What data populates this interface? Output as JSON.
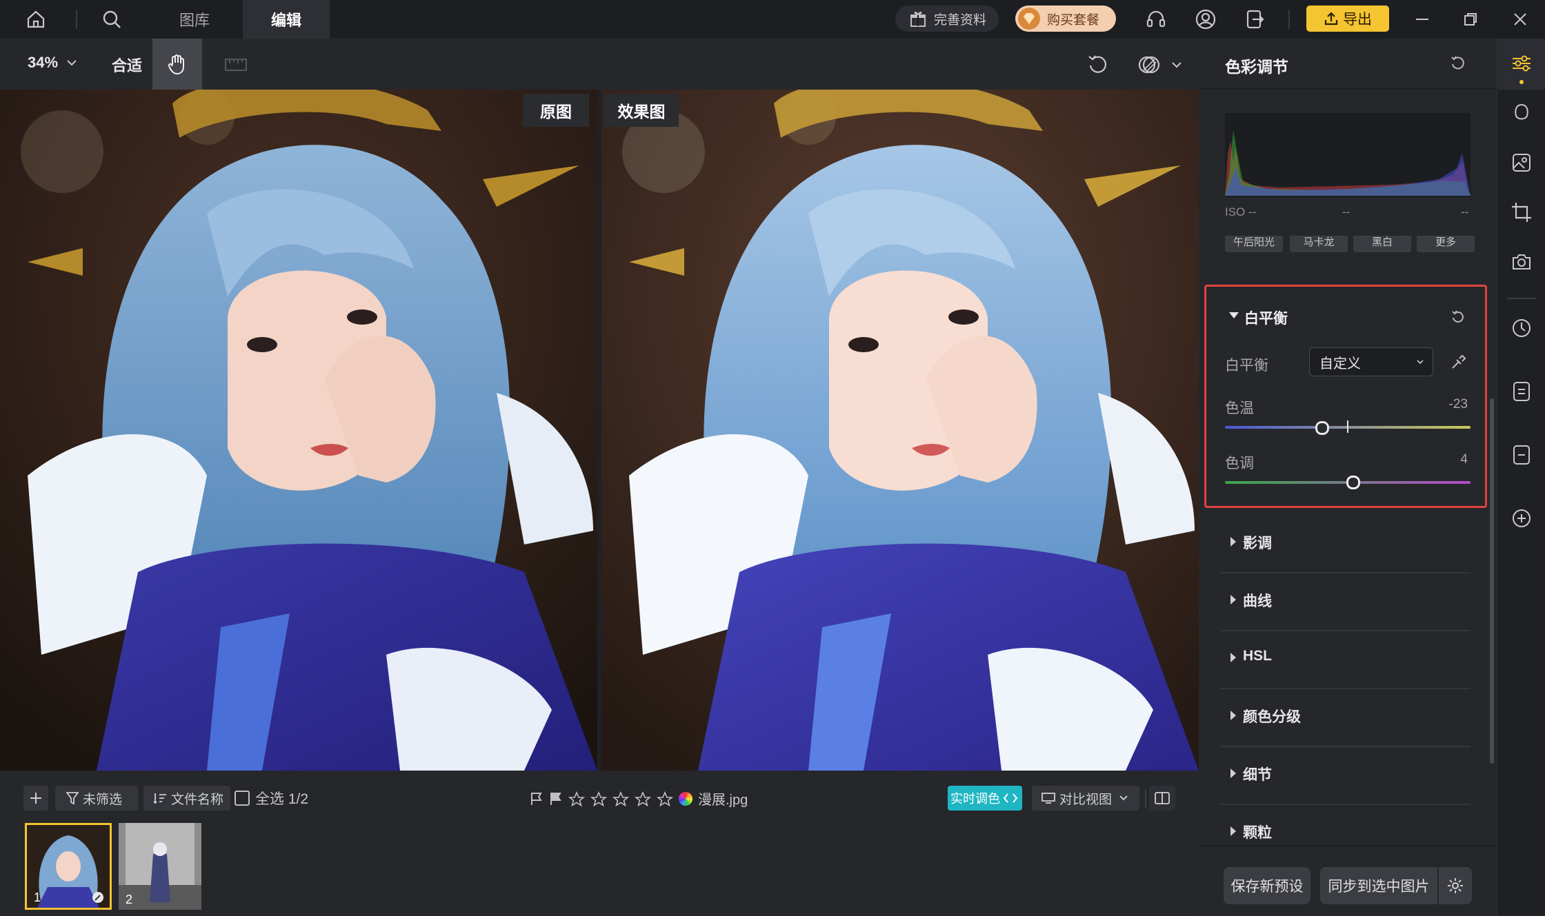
{
  "topbar": {
    "tabs": [
      {
        "label": "图库"
      },
      {
        "label": "编辑"
      }
    ],
    "complete_info": "完善资料",
    "buy_package": "购买套餐",
    "export": "导出"
  },
  "toolbar": {
    "zoom": "34%",
    "fit": "合适"
  },
  "viewer": {
    "original_label": "原图",
    "effect_label": "效果图"
  },
  "bottom": {
    "filter": "未筛选",
    "sort": "文件名称",
    "select_all": "全选 1/2",
    "filename": "漫展.jpg",
    "realtime": "实时调色",
    "compare": "对比视图",
    "thumbnails": [
      {
        "index": "1"
      },
      {
        "index": "2"
      }
    ]
  },
  "panel": {
    "title": "色彩调节",
    "histogram": {
      "iso": "ISO --",
      "mid": "--",
      "right": "--"
    },
    "presets": [
      "午后阳光",
      "马卡龙",
      "黑白",
      "更多"
    ],
    "white_balance": {
      "title": "白平衡",
      "label": "白平衡",
      "select_value": "自定义",
      "temperature_label": "色温",
      "temperature_value": "-23",
      "tint_label": "色调",
      "tint_value": "4"
    },
    "sections": [
      "影调",
      "曲线",
      "HSL",
      "颜色分级",
      "细节",
      "颗粒"
    ],
    "save_preset": "保存新预设",
    "sync": "同步到选中图片"
  },
  "colors": {
    "accent_gold": "#f5c431",
    "highlight_red": "#e0443c",
    "realtime_teal": "#1fb6c4"
  }
}
